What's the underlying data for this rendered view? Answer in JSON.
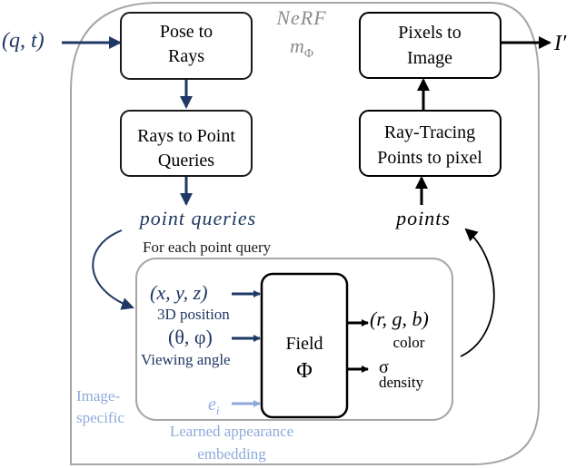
{
  "colors": {
    "dark_blue": "#1f3864",
    "light_blue": "#8eaadb",
    "gray": "#a6a6a6",
    "gray_text": "#8c8c8c",
    "black": "#000000"
  },
  "nerf": {
    "title": "NeRF",
    "subtitle": "m",
    "subtitle_sub": "Φ"
  },
  "input": {
    "label": "(q, t)"
  },
  "output": {
    "label": "I′"
  },
  "boxes": {
    "pose_to_rays": {
      "line1": "Pose to",
      "line2": "Rays"
    },
    "rays_to_points": {
      "line1": "Rays to Point",
      "line2": "Queries"
    },
    "pixels_to_image": {
      "line1": "Pixels to",
      "line2": "Image"
    },
    "ray_tracing": {
      "line1": "Ray-Tracing",
      "line2": "Points to pixel"
    },
    "field": {
      "line1": "Field",
      "line2": "Φ"
    }
  },
  "labels": {
    "point_queries": "point queries",
    "for_each": "For each point query",
    "points": "points",
    "xyz": "(x, y, z)",
    "position": "3D position",
    "angles": "(θ, φ)",
    "viewing_angle": "Viewing angle",
    "ei": "e",
    "ei_sub": "i",
    "image_specific_1": "Image-",
    "image_specific_2": "specific",
    "learned_1": "Learned appearance",
    "learned_2": "embedding",
    "rgb": "(r, g, b)",
    "color": "color",
    "sigma": "σ",
    "density": "density"
  }
}
